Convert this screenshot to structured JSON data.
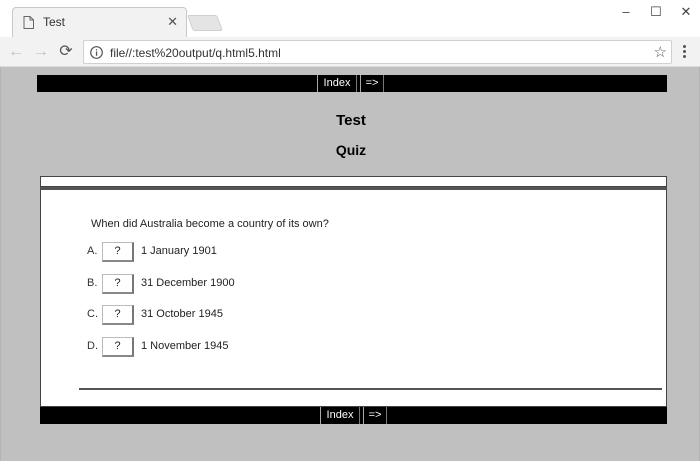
{
  "browser": {
    "tab_title": "Test",
    "url": "file//:test%20output/q.html5.html",
    "tab_close": "✕",
    "window_controls": {
      "minimize": "–",
      "maximize": "☐",
      "close": "✕"
    },
    "nav": {
      "back": "←",
      "forward": "→",
      "reload": "⟳"
    },
    "bookmark_star": "☆"
  },
  "page": {
    "nav": {
      "index": "Index",
      "next": "=>"
    },
    "title": "Test",
    "subtitle": "Quiz",
    "question": "When did Australia become a country of its own?",
    "answers": [
      {
        "letter": "A.",
        "button": "?",
        "text": "1 January 1901"
      },
      {
        "letter": "B.",
        "button": "?",
        "text": "31 December 1900"
      },
      {
        "letter": "C.",
        "button": "?",
        "text": "31 October 1945"
      },
      {
        "letter": "D.",
        "button": "?",
        "text": "1 November 1945"
      }
    ]
  },
  "colors": {
    "page_background": "#c0c0c0",
    "nav_bar": "#000000",
    "panel": "#ffffff"
  }
}
